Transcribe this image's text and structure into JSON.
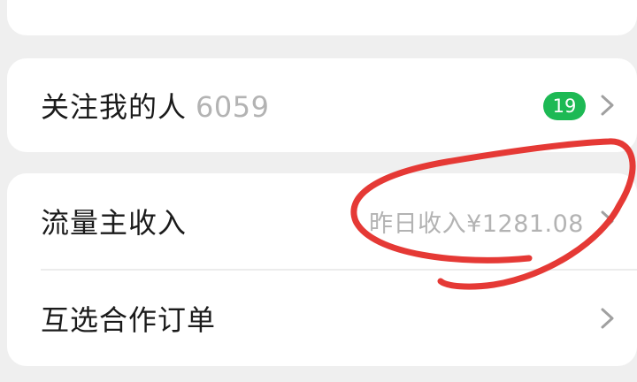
{
  "rows": {
    "followers": {
      "label": "关注我的人",
      "count": "6059",
      "badge": "19"
    },
    "income": {
      "label": "流量主收入",
      "summary": "昨日收入¥1281.08"
    },
    "orders": {
      "label": "互选合作订单"
    }
  },
  "icons": {
    "chevron": "chevron-right-icon"
  },
  "colors": {
    "badge": "#1db954",
    "annotation": "#e53935",
    "secondary_text": "#b3b3b3"
  }
}
